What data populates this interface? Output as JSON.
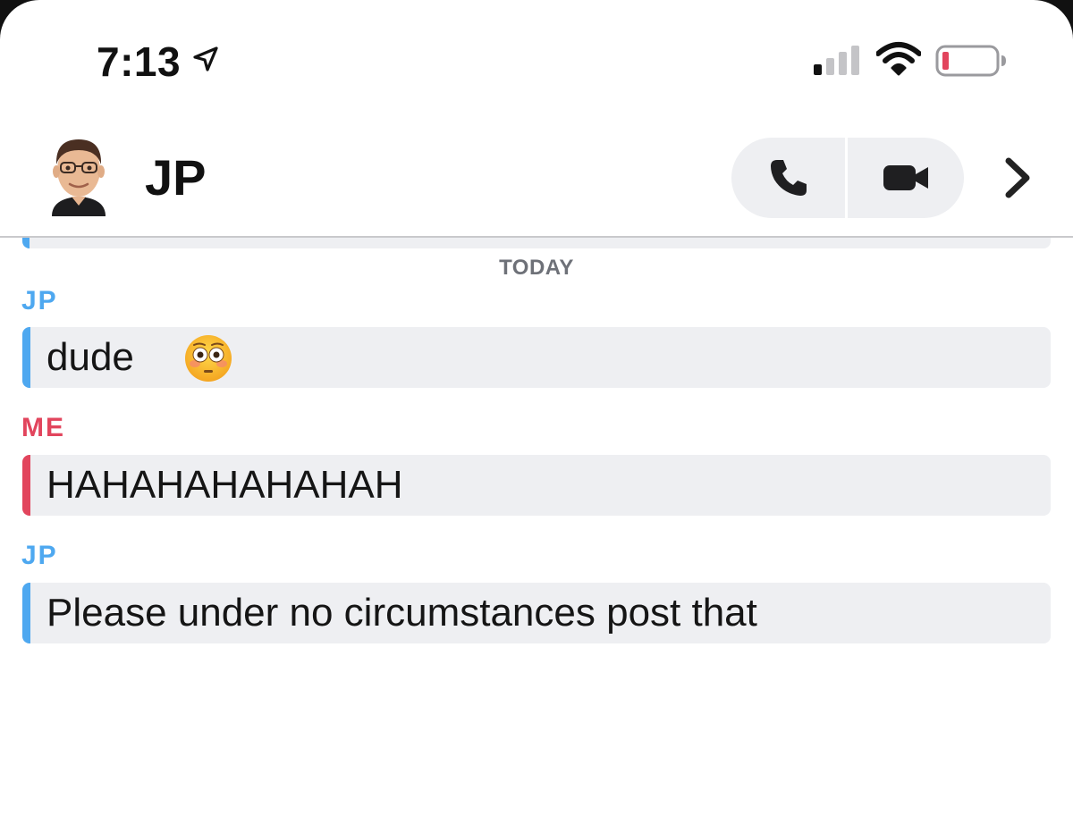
{
  "status_bar": {
    "time": "7:13",
    "icons": [
      "location-arrow-icon",
      "signal-icon",
      "wifi-icon",
      "battery-icon"
    ]
  },
  "header": {
    "title": "JP",
    "avatar_icon": "bitmoji-avatar",
    "actions": [
      "phone-icon",
      "video-camera-icon",
      "chevron-right-icon"
    ]
  },
  "chat": {
    "date_label": "TODAY",
    "messages": [
      {
        "sender": "JP",
        "text": "dude",
        "emoji": "flushed-face-icon",
        "side": "them"
      },
      {
        "sender": "ME",
        "text": "HAHAHAHAHAHAH",
        "side": "me"
      },
      {
        "sender": "JP",
        "text": "Please under no circumstances post that",
        "side": "them"
      }
    ]
  },
  "colors": {
    "them_accent": "#4ea8f0",
    "me_accent": "#e2455d",
    "bubble_bg": "#eeeff2",
    "battery_low": "#e2455d"
  }
}
